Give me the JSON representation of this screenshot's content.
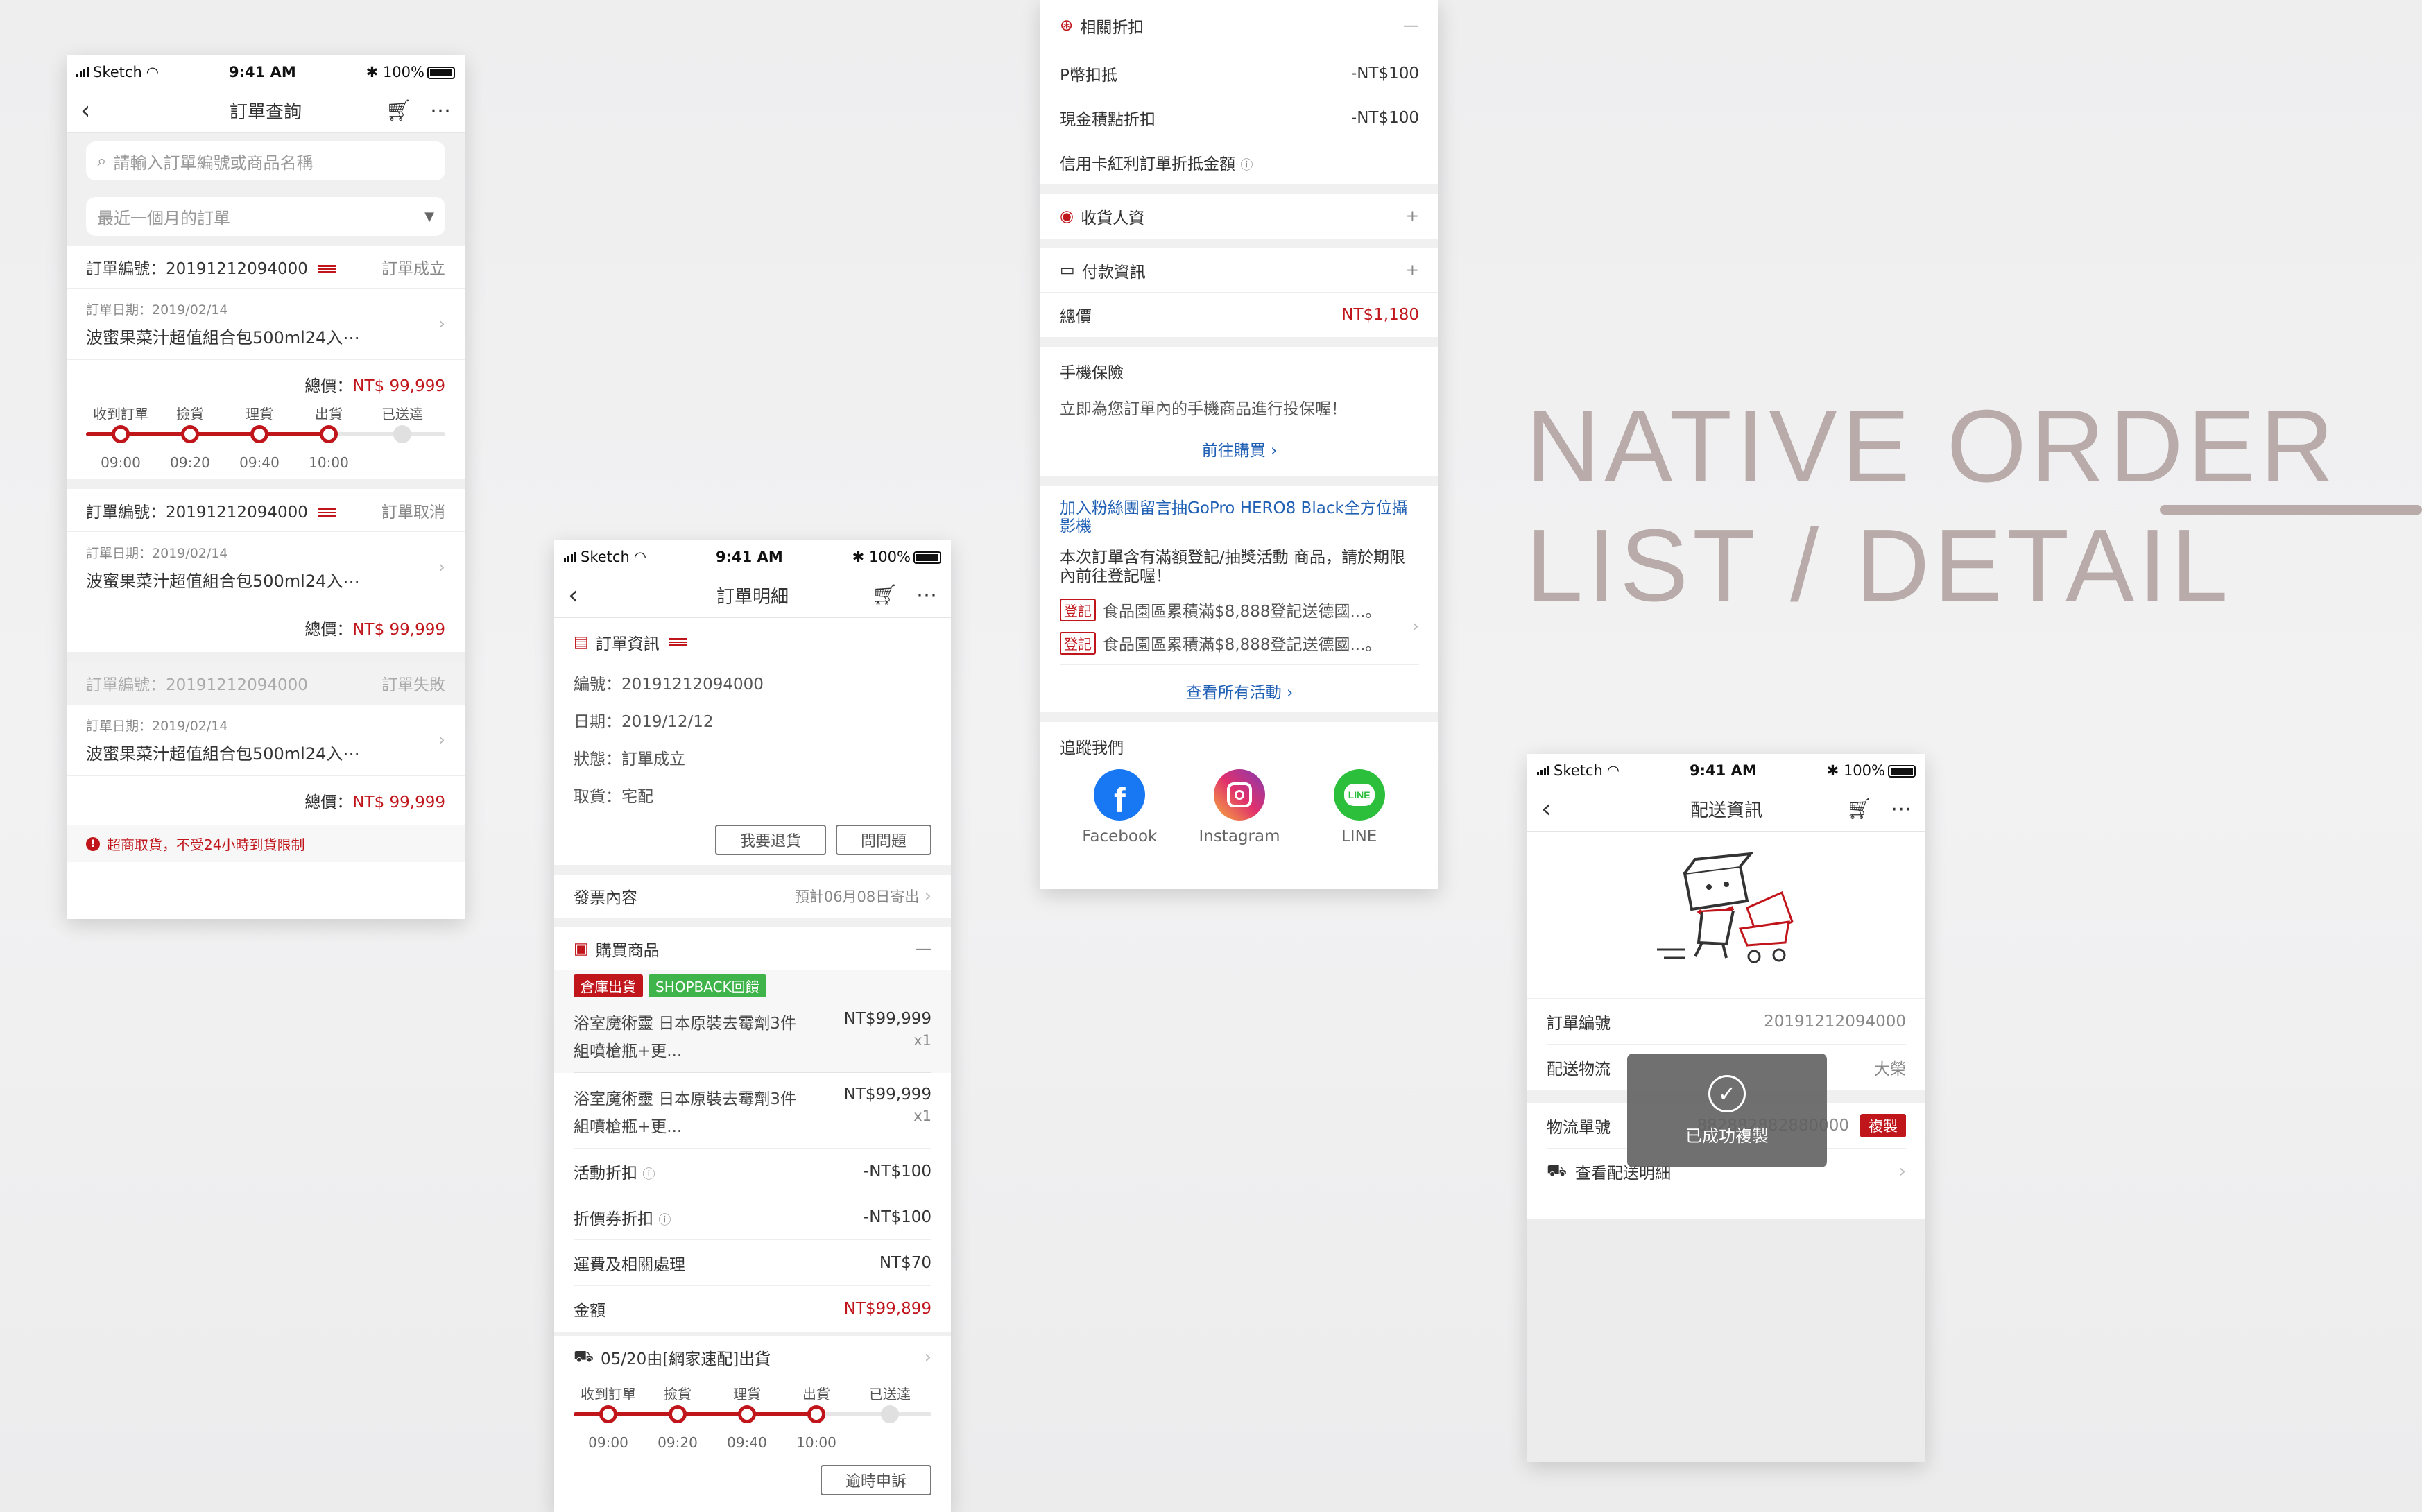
{
  "hero": {
    "line1": "NATIVE ORDER",
    "line2": "LIST / DETAIL"
  },
  "status": {
    "carrier": "Sketch",
    "time": "9:41 AM",
    "battery": "100%"
  },
  "colors": {
    "accent": "#c0151b",
    "link": "#1f5fb4",
    "green": "#3fb44a",
    "hero": "#b9abaa"
  },
  "list": {
    "title": "訂單查詢",
    "search_placeholder": "請輸入訂單編號或商品名稱",
    "filter": "最近一個月的訂單",
    "orders": [
      {
        "no": "訂單編號：20191212094000",
        "status": "訂單成立",
        "date": "訂單日期：2019/02/14",
        "name": "波蜜果菜汁超值組合包500ml24入⋯",
        "total_label": "總價：",
        "total": "NT$ 99,999"
      },
      {
        "no": "訂單編號：20191212094000",
        "status": "訂單取消",
        "date": "訂單日期：2019/02/14",
        "name": "波蜜果菜汁超值組合包500ml24入⋯",
        "total_label": "總價：",
        "total": "NT$ 99,999"
      },
      {
        "no": "訂單編號：20191212094000",
        "status": "訂單失敗",
        "date": "訂單日期：2019/02/14",
        "name": "波蜜果菜汁超值組合包500ml24入⋯",
        "total_label": "總價：",
        "total": "NT$ 99,999"
      }
    ],
    "timeline_labels": [
      "收到訂單",
      "撿貨",
      "理貨",
      "出貨",
      "已送達"
    ],
    "timeline_times": [
      "09:00",
      "09:20",
      "09:40",
      "10:00"
    ],
    "notice": "超商取貨，不受24小時到貨限制"
  },
  "detail": {
    "title": "訂單明細",
    "info_title": "訂單資訊",
    "info": [
      "編號：20191212094000",
      "日期：2019/12/12",
      "狀態：訂單成立",
      "取貨：宅配"
    ],
    "btn_return": "我要退貨",
    "btn_ask": "問問題",
    "invoice_label": "發票內容",
    "invoice_value": "預計06月08日寄出",
    "products_title": "購買商品",
    "tag1": "倉庫出貨",
    "tag2": "SHOPBACK回饋",
    "products": [
      {
        "name1": "浴室魔術靈 日本原裝去霉劑3件",
        "name2": "組噴槍瓶+更...",
        "price": "NT$99,999",
        "qty": "x1"
      },
      {
        "name1": "浴室魔術靈 日本原裝去霉劑3件",
        "name2": "組噴槍瓶+更...",
        "price": "NT$99,999",
        "qty": "x1"
      }
    ],
    "fees": [
      {
        "label": "活動折扣",
        "value": "-NT$100"
      },
      {
        "label": "折價券折扣",
        "value": "-NT$100"
      },
      {
        "label": "運費及相關處理",
        "value": "NT$70"
      }
    ],
    "amount_label": "金額",
    "amount_value": "NT$99,899",
    "ship_label": "05/20由[網家速配]出貨",
    "timeline_labels": [
      "收到訂單",
      "撿貨",
      "理貨",
      "出貨",
      "已送達"
    ],
    "timeline_times": [
      "09:00",
      "09:20",
      "09:40",
      "10:00"
    ],
    "btn_complain": "逾時申訴"
  },
  "middle": {
    "discount_title": "相關折扣",
    "discounts": [
      {
        "label": "P幣扣抵",
        "value": "-NT$100"
      },
      {
        "label": "現金積點折扣",
        "value": "-NT$100"
      },
      {
        "label": "信用卡紅利訂單折抵金額",
        "value": ""
      }
    ],
    "receiver_title": "收貨人資",
    "payment_title": "付款資訊",
    "total_label": "總價",
    "total_value": "NT$1,180",
    "insurance_title": "手機保險",
    "insurance_desc": "立即為您訂單內的手機商品進行投保喔！",
    "insurance_link": "前往購買",
    "promo_title": "加入粉絲團留言抽GoPro HERO8 Black全方位攝影機",
    "promo_desc": "本次訂單含有滿額登記/抽獎活動 商品，請於期限內前往登記喔！",
    "promo_tag": "登記",
    "promo_items": [
      "食品園區累積滿$8,888登記送德國...。",
      "食品園區累積滿$8,888登記送德國...。"
    ],
    "promo_all": "查看所有活動",
    "follow_title": "追蹤我們",
    "socials": [
      {
        "name": "Facebook"
      },
      {
        "name": "Instagram"
      },
      {
        "name": "LINE",
        "logo": "LINE"
      }
    ]
  },
  "delivery": {
    "title": "配送資訊",
    "rows": [
      {
        "label": "訂單編號",
        "value": "20191212094000"
      },
      {
        "label": "配送物流",
        "value": "大榮"
      }
    ],
    "tracking_label": "物流單號",
    "tracking_value": "882882882880000",
    "copy_btn": "複製",
    "view_detail": "查看配送明細",
    "toast": "已成功複製"
  }
}
